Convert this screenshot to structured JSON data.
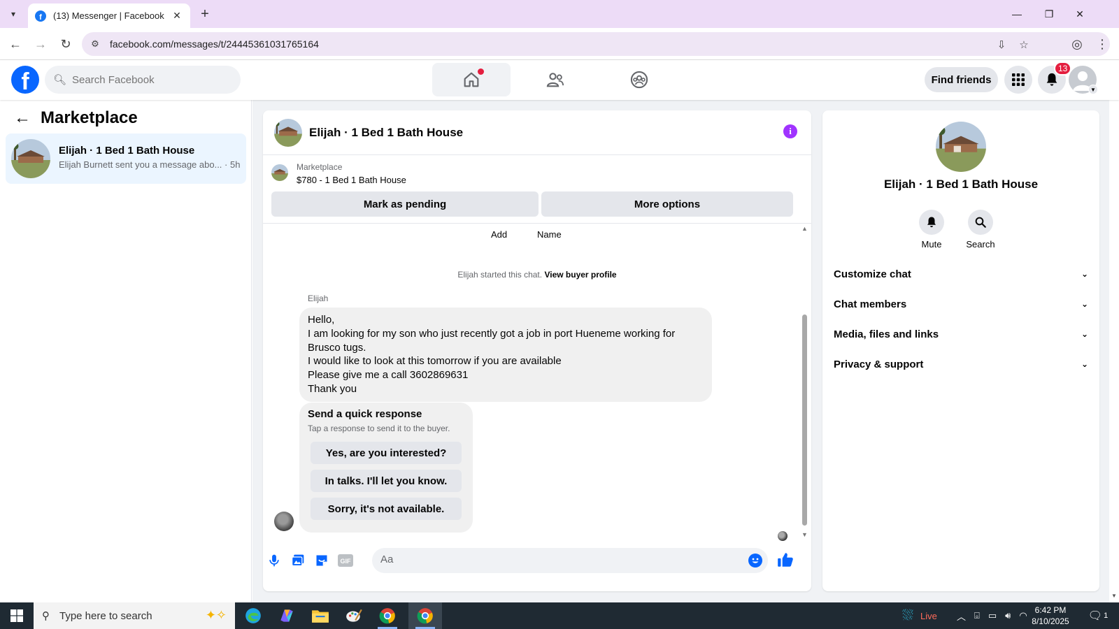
{
  "browser": {
    "tab_title": "(13) Messenger | Facebook",
    "url": "facebook.com/messages/t/24445361031765164"
  },
  "header": {
    "search_placeholder": "Search Facebook",
    "find_friends": "Find friends",
    "notification_count": "13"
  },
  "left_panel": {
    "title": "Marketplace",
    "conversation": {
      "name": "Elijah · 1 Bed 1 Bath House",
      "preview": "Elijah Burnett sent you a message abo... · 5h"
    }
  },
  "chat": {
    "title": "Elijah · 1 Bed 1 Bath House",
    "listing_label": "Marketplace",
    "listing_price": "$780 - 1 Bed 1 Bath House",
    "mark_pending": "Mark as pending",
    "more_options": "More options",
    "col_add": "Add",
    "col_name": "Name",
    "start_note": "Elijah started this chat.",
    "view_profile": "View buyer profile",
    "sender": "Elijah",
    "message_lines": [
      "Hello,",
      "I am looking for my son who just recently got a job in port Hueneme working for",
      "Brusco tugs.",
      "I would like to look at this tomorrow if you are available",
      "Please give me a call 3602869631",
      "Thank you"
    ],
    "quick_title": "Send a quick response",
    "quick_sub": "Tap a response to send it to the buyer.",
    "quick_replies": [
      "Yes, are you interested?",
      "In talks. I'll let you know.",
      "Sorry, it's not available."
    ],
    "composer_placeholder": "Aa"
  },
  "right_panel": {
    "name": "Elijah · 1 Bed 1 Bath House",
    "mute": "Mute",
    "search": "Search",
    "sections": [
      "Customize chat",
      "Chat members",
      "Media, files and links",
      "Privacy & support"
    ]
  },
  "taskbar": {
    "search_placeholder": "Type here to search",
    "weather": "Live",
    "time": "6:42 PM",
    "date": "8/10/2025",
    "notif_count": "1"
  },
  "colors": {
    "fb_blue": "#0866ff",
    "accent_purple": "#a033ff",
    "selected_row": "#ebf5ff",
    "badge_red": "#e41e3f"
  }
}
